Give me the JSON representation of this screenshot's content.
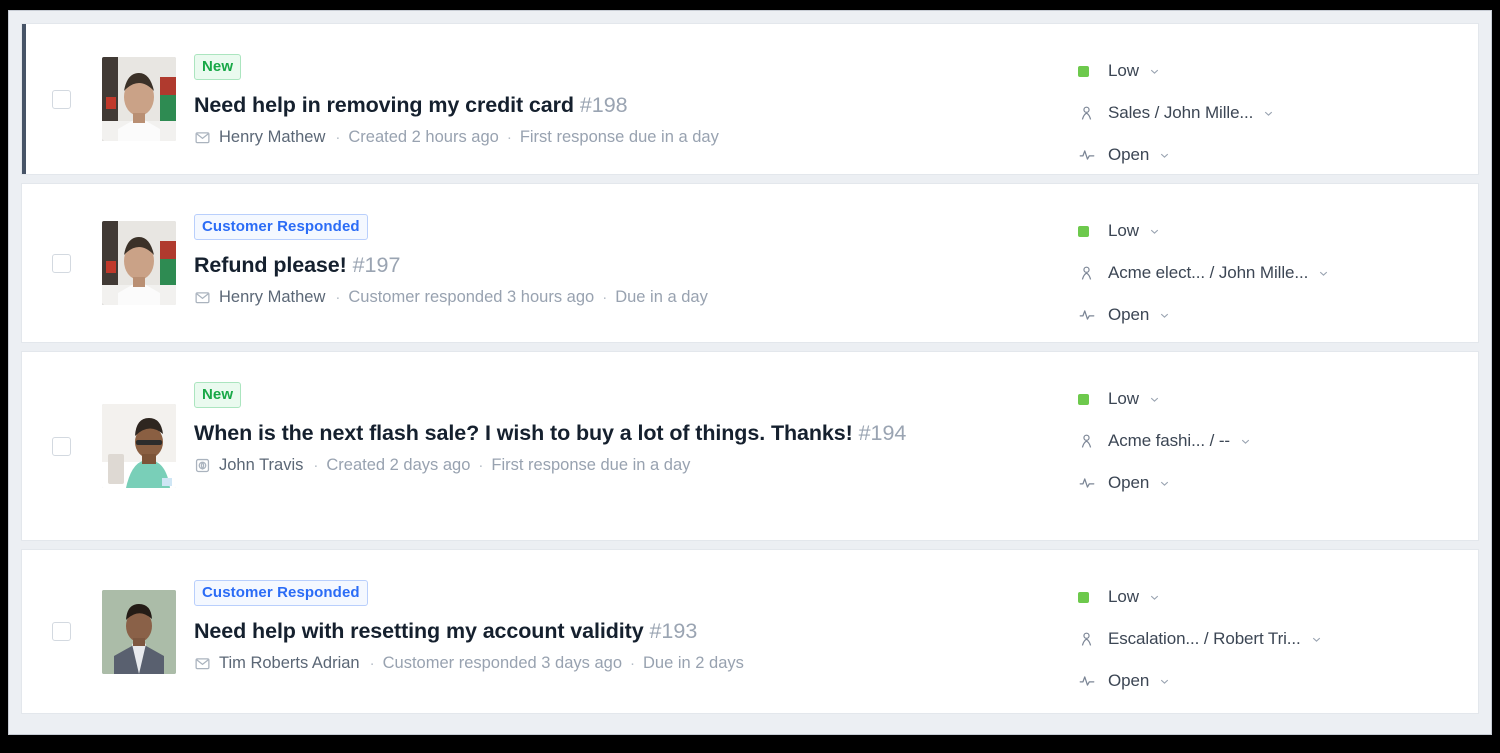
{
  "theme": {
    "page_background": "#eceff3",
    "row_background": "#ffffff",
    "selected_indicator": "#475467",
    "priority_low_color": "#6dc94c",
    "badge_new_color": "#18a847",
    "badge_responded_color": "#2b6cf6"
  },
  "ticket_list": {
    "rows": [
      {
        "selected": true,
        "checkbox_checked": false,
        "badge": {
          "label": "New",
          "style": "new"
        },
        "subject": "Need help in removing my credit card",
        "ticket_id": "#198",
        "channel_icon": "email-icon",
        "requester": "Henry Mathew",
        "activity": "Created 2 hours ago",
        "sla": "First response due in a day",
        "priority": "Low",
        "assignment": "Sales / John Mille...",
        "status": "Open",
        "avatar": "avatar-henry-mathew"
      },
      {
        "selected": false,
        "checkbox_checked": false,
        "badge": {
          "label": "Customer Responded",
          "style": "responded"
        },
        "subject": "Refund please!",
        "ticket_id": "#197",
        "channel_icon": "email-icon",
        "requester": "Henry Mathew",
        "activity": "Customer responded 3 hours ago",
        "sla": "Due in a day",
        "priority": "Low",
        "assignment": "Acme elect... / John Mille...",
        "status": "Open",
        "avatar": "avatar-henry-mathew"
      },
      {
        "selected": false,
        "checkbox_checked": false,
        "badge": {
          "label": "New",
          "style": "new"
        },
        "subject": "When is the next flash sale? I wish to buy a lot of things. Thanks!",
        "ticket_id": "#194",
        "channel_icon": "portal-icon",
        "requester": "John Travis",
        "activity": "Created 2 days ago",
        "sla": "First response due in a day",
        "priority": "Low",
        "assignment": "Acme fashi... / --",
        "status": "Open",
        "avatar": "avatar-john-travis"
      },
      {
        "selected": false,
        "checkbox_checked": false,
        "badge": {
          "label": "Customer Responded",
          "style": "responded"
        },
        "subject": "Need help with resetting my account validity",
        "ticket_id": "#193",
        "channel_icon": "email-icon",
        "requester": "Tim Roberts Adrian",
        "activity": "Customer responded 3 days ago",
        "sla": "Due in 2 days",
        "priority": "Low",
        "assignment": "Escalation... / Robert Tri...",
        "status": "Open",
        "avatar": "avatar-tim-roberts-adrian"
      }
    ],
    "separator": "·"
  }
}
